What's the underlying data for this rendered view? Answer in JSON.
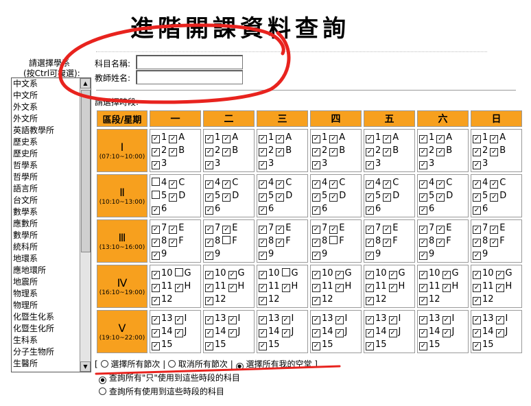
{
  "page_title": "進階開課資料查詢",
  "dept_label": "請選擇學系",
  "dept_hint": "(按Ctrl可複選):",
  "subject_label": "科目名稱:",
  "teacher_label": "教師姓名:",
  "subject_value": "",
  "teacher_value": "",
  "period_label": "請選擇時段:",
  "departments": [
    "中文系",
    "中文所",
    "外文系",
    "外文所",
    "英語教學所",
    "歷史系",
    "歷史所",
    "哲學系",
    "哲學所",
    "語言所",
    "台文所",
    "數學系",
    "應數所",
    "數學所",
    "統科所",
    "地環系",
    "應地環所",
    "地震所",
    "物理系",
    "物理所",
    "化暨生化系",
    "化暨生化所",
    "生科系",
    "分子生物所",
    "生醫所"
  ],
  "grid": {
    "corner": "區段/星期",
    "days": [
      "一",
      "二",
      "三",
      "四",
      "五",
      "六",
      "日"
    ],
    "slots": [
      {
        "roman": "Ⅰ",
        "time": "(07:10~10:00)",
        "lines": [
          [
            {
              "n": "1"
            },
            {
              "n": "A"
            }
          ],
          [
            {
              "n": "2"
            },
            {
              "n": "B"
            }
          ],
          [
            {
              "n": "3"
            }
          ]
        ],
        "unchecked": {}
      },
      {
        "roman": "Ⅱ",
        "time": "(10:10~13:00)",
        "lines": [
          [
            {
              "n": "4"
            },
            {
              "n": "C"
            }
          ],
          [
            {
              "n": "5"
            },
            {
              "n": "D"
            }
          ],
          [
            {
              "n": "6"
            }
          ]
        ],
        "unchecked": {
          "0": [
            "4",
            "5"
          ]
        }
      },
      {
        "roman": "Ⅲ",
        "time": "(13:10~16:00)",
        "lines": [
          [
            {
              "n": "7"
            },
            {
              "n": "E"
            }
          ],
          [
            {
              "n": "8"
            },
            {
              "n": "F"
            }
          ],
          [
            {
              "n": "9"
            }
          ]
        ],
        "unchecked": {
          "1": [
            "F"
          ],
          "3": [
            "F"
          ]
        }
      },
      {
        "roman": "Ⅳ",
        "time": "(16:10~19:00)",
        "lines": [
          [
            {
              "n": "10"
            },
            {
              "n": "G"
            }
          ],
          [
            {
              "n": "11"
            },
            {
              "n": "H"
            }
          ],
          [
            {
              "n": "12"
            }
          ]
        ],
        "unchecked": {
          "0": [
            "G"
          ],
          "2": [
            "G"
          ]
        }
      },
      {
        "roman": "Ⅴ",
        "time": "(19:10~22:00)",
        "lines": [
          [
            {
              "n": "13"
            },
            {
              "n": "I"
            }
          ],
          [
            {
              "n": "14"
            },
            {
              "n": "J"
            }
          ],
          [
            {
              "n": "15"
            }
          ]
        ],
        "unchecked": {}
      }
    ]
  },
  "bulk": {
    "open": "[",
    "close": "]",
    "sep": "|",
    "select_all": "選擇所有節次",
    "clear_all": "取消所有節次",
    "my_free": "選擇所有我的空堂",
    "selected": "my_free"
  },
  "query": {
    "only": "查詢所有\"只\"使用到這些時段的科目",
    "any": "查詢所有使用到這些時段的科目",
    "selected": "only"
  },
  "colors": {
    "header": "#f7a01e",
    "annotation": "#e8231e"
  }
}
